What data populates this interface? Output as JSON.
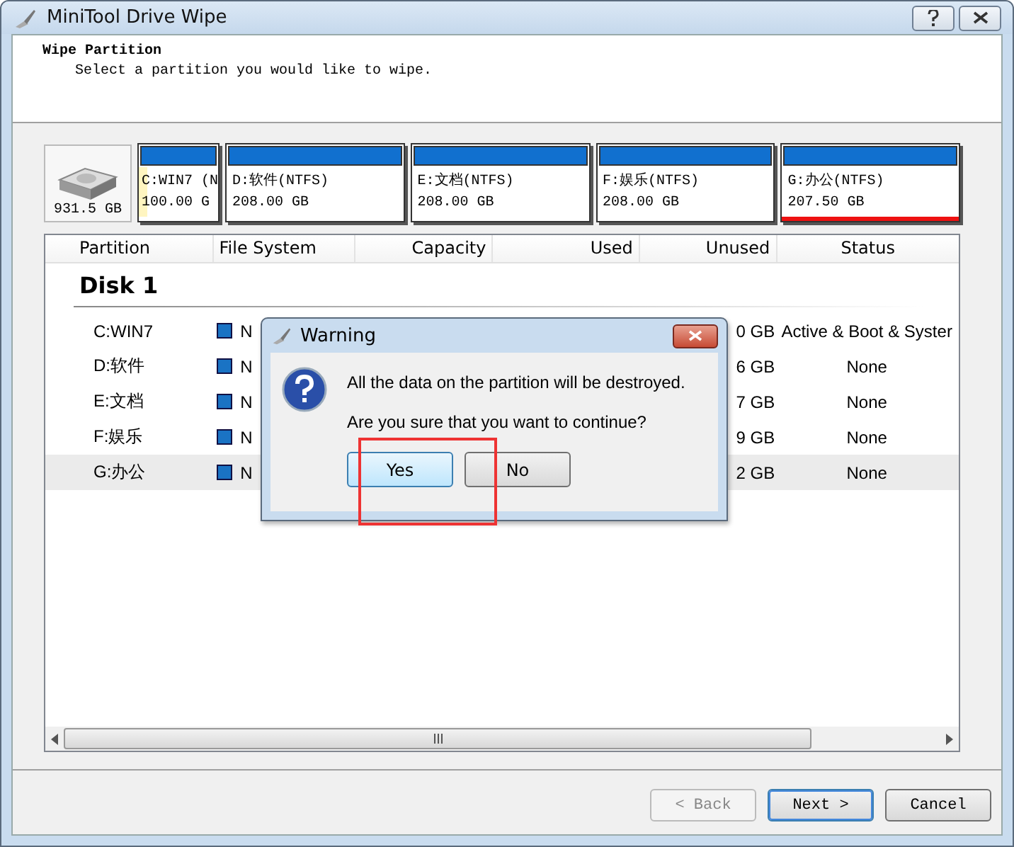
{
  "window": {
    "title": "MiniTool Drive Wipe"
  },
  "header": {
    "title": "Wipe Partition",
    "subtitle": "Select a partition you would like to wipe."
  },
  "disk_map": {
    "disk_size": "931.5 GB",
    "partitions": [
      {
        "label": "C:WIN7 (N",
        "size": "100.00 G",
        "level": 0.1,
        "selected": false
      },
      {
        "label": "D:软件(NTFS)",
        "size": "208.00 GB",
        "selected": false
      },
      {
        "label": "E:文档(NTFS)",
        "size": "208.00 GB",
        "selected": false
      },
      {
        "label": "F:娱乐(NTFS)",
        "size": "208.00 GB",
        "selected": false
      },
      {
        "label": "G:办公(NTFS)",
        "size": "207.50 GB",
        "selected": true
      }
    ]
  },
  "table": {
    "columns": [
      "Partition",
      "File System",
      "Capacity",
      "Used",
      "Unused",
      "Status"
    ],
    "group": "Disk 1",
    "rows": [
      {
        "partition": "C:WIN7",
        "file_system": "N",
        "unused": "0 GB",
        "status": "Active & Boot & Syster",
        "selected": false
      },
      {
        "partition": "D:软件",
        "file_system": "N",
        "unused": "6 GB",
        "status": "None",
        "selected": false
      },
      {
        "partition": "E:文档",
        "file_system": "N",
        "unused": "7 GB",
        "status": "None",
        "selected": false
      },
      {
        "partition": "F:娱乐",
        "file_system": "N",
        "unused": "9 GB",
        "status": "None",
        "selected": false
      },
      {
        "partition": "G:办公",
        "file_system": "N",
        "unused": "2 GB",
        "status": "None",
        "selected": true
      }
    ]
  },
  "dialog": {
    "title": "Warning",
    "message": "All the data on the partition will be destroyed.",
    "question": "Are you sure that you want to continue?",
    "buttons": [
      {
        "label": "Yes",
        "selected": true
      },
      {
        "label": "No",
        "selected": false
      }
    ]
  },
  "footer": {
    "buttons": [
      {
        "label": "< Back",
        "disabled": true,
        "selected": false
      },
      {
        "label": "Next >",
        "disabled": false,
        "selected": true
      },
      {
        "label": "Cancel",
        "disabled": false,
        "selected": false
      }
    ]
  }
}
